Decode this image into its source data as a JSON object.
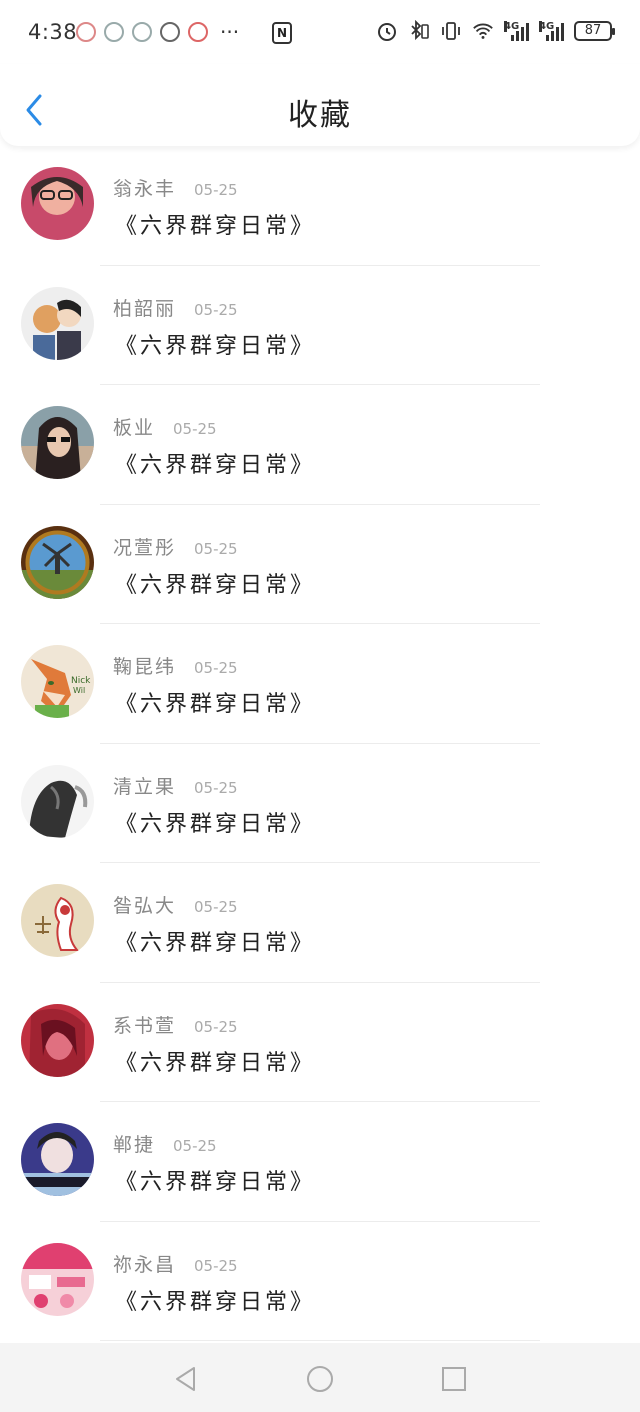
{
  "status_bar": {
    "time": "4:38",
    "more": "···",
    "net1": "4G",
    "net2": "4G",
    "battery": "87"
  },
  "header": {
    "title": "收藏",
    "back_icon": "chevron-left-icon",
    "accent": "#2b8be6"
  },
  "items": [
    {
      "name": "翁永丰",
      "date": "05-25",
      "book": "《六界群穿日常》",
      "avatar_colors": [
        "#c84a6a",
        "#f0b0a0"
      ]
    },
    {
      "name": "柏韶丽",
      "date": "05-25",
      "book": "《六界群穿日常》",
      "avatar_colors": [
        "#e0a060",
        "#3a3a4a"
      ]
    },
    {
      "name": "板业",
      "date": "05-25",
      "book": "《六界群穿日常》",
      "avatar_colors": [
        "#b8a088",
        "#3a3030"
      ]
    },
    {
      "name": "况萱彤",
      "date": "05-25",
      "book": "《六界群穿日常》",
      "avatar_colors": [
        "#6a3a10",
        "#5a9ad0"
      ]
    },
    {
      "name": "鞠昆纬",
      "date": "05-25",
      "book": "《六界群穿日常》",
      "avatar_colors": [
        "#f0e6d6",
        "#e07a3a"
      ]
    },
    {
      "name": "清立果",
      "date": "05-25",
      "book": "《六界群穿日常》",
      "avatar_colors": [
        "#f2f2f2",
        "#333333"
      ]
    },
    {
      "name": "昝弘大",
      "date": "05-25",
      "book": "《六界群穿日常》",
      "avatar_colors": [
        "#e8dcc0",
        "#c83a3a"
      ]
    },
    {
      "name": "系书萱",
      "date": "05-25",
      "book": "《六界群穿日常》",
      "avatar_colors": [
        "#c03040",
        "#e07080"
      ]
    },
    {
      "name": "郸捷",
      "date": "05-25",
      "book": "《六界群穿日常》",
      "avatar_colors": [
        "#3a3a8a",
        "#a0c0e0"
      ]
    },
    {
      "name": "祢永昌",
      "date": "05-25",
      "book": "《六界群穿日常》",
      "avatar_colors": [
        "#e04070",
        "#f6d0d8"
      ]
    }
  ],
  "nav": {
    "back_icon": "triangle-back-icon",
    "home_icon": "circle-home-icon",
    "recents_icon": "square-recents-icon"
  }
}
